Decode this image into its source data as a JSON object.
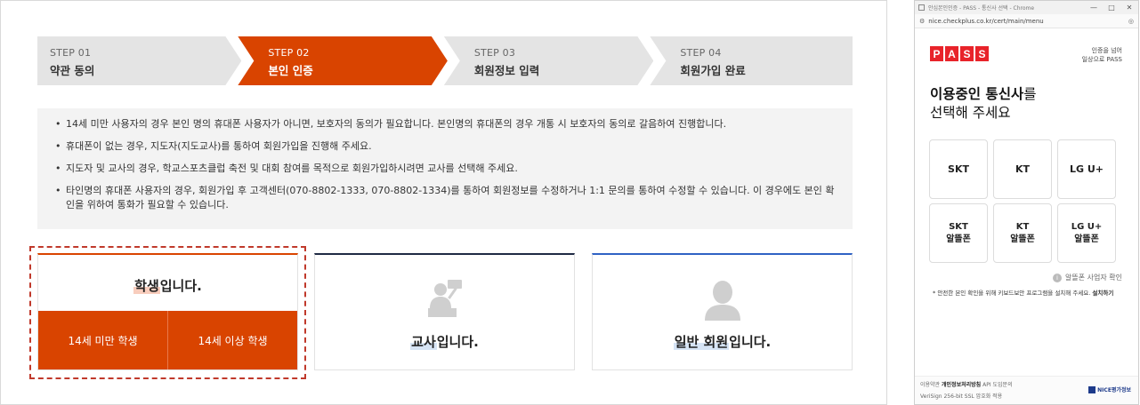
{
  "steps": [
    {
      "num": "STEP 01",
      "label": "약관 동의"
    },
    {
      "num": "STEP 02",
      "label": "본인 인증"
    },
    {
      "num": "STEP 03",
      "label": "회원정보 입력"
    },
    {
      "num": "STEP 04",
      "label": "회원가입 완료"
    }
  ],
  "notices": [
    "14세 미만 사용자의 경우 본인 명의 휴대폰 사용자가 아니면, 보호자의 동의가 필요합니다. 본인명의 휴대폰의 경우 개통 시 보호자의 동의로 갈음하여 진행합니다.",
    "휴대폰이 없는 경우, 지도자(지도교사)를 통하여 회원가입을 진행해 주세요.",
    "지도자 및 교사의 경우, 학교스포츠클럽 축전 및 대회 참여를 목적으로 회원가입하시려면 교사를 선택해 주세요.",
    "타인명의 휴대폰 사용자의 경우, 회원가입 후 고객센터(070-8802-1333, 070-8802-1334)를 통하여 회원정보를 수정하거나 1:1 문의를 통하여 수정할 수 있습니다. 이 경우에도 본인 확인을 위하여 통화가 필요할 수 있습니다."
  ],
  "cards": {
    "student": {
      "highlight": "학생",
      "suffix": "입니다.",
      "buttons": [
        "14세 미만 학생",
        "14세 이상 학생"
      ]
    },
    "teacher": {
      "highlight": "교사",
      "suffix": "입니다."
    },
    "general": {
      "highlight": "일반 회원",
      "suffix": "입니다."
    }
  },
  "colors": {
    "accent": "#d94400",
    "teacher": "#1f2a44",
    "general": "#2f62c4",
    "pass": "#e8232a"
  },
  "popup": {
    "window_title": "안심본인인증 - PASS - 통신사 선택 - Chrome",
    "url": "nice.checkplus.co.kr/cert/main/menu",
    "logo_letters": [
      "P",
      "A",
      "S",
      "S"
    ],
    "tagline": [
      "인증을 넘어",
      "일상으로 PASS"
    ],
    "headline_bold": "이용중인 통신사",
    "headline_rest": "를",
    "headline_line2": "선택해 주세요",
    "carriers": [
      {
        "line1": "SKT",
        "line2": ""
      },
      {
        "line1": "KT",
        "line2": ""
      },
      {
        "line1": "LG U+",
        "line2": ""
      },
      {
        "line1": "SKT",
        "line2": "알뜰폰"
      },
      {
        "line1": "KT",
        "line2": "알뜰폰"
      },
      {
        "line1": "LG U+",
        "line2": "알뜰폰"
      }
    ],
    "mvno_info": "알뜰폰 사업자 확인",
    "security_note": "* 안전한 본인 확인을 위해 키보드보안 프로그램을 설치해 주세요.",
    "security_link": "설치하기",
    "footer_links": [
      "이용약관",
      "개인정보처리방침",
      "API 도입문의"
    ],
    "footer_ssl": "VeriSign 256-bit SSL 암호화 적용",
    "footer_brand": "NICE평가정보"
  }
}
